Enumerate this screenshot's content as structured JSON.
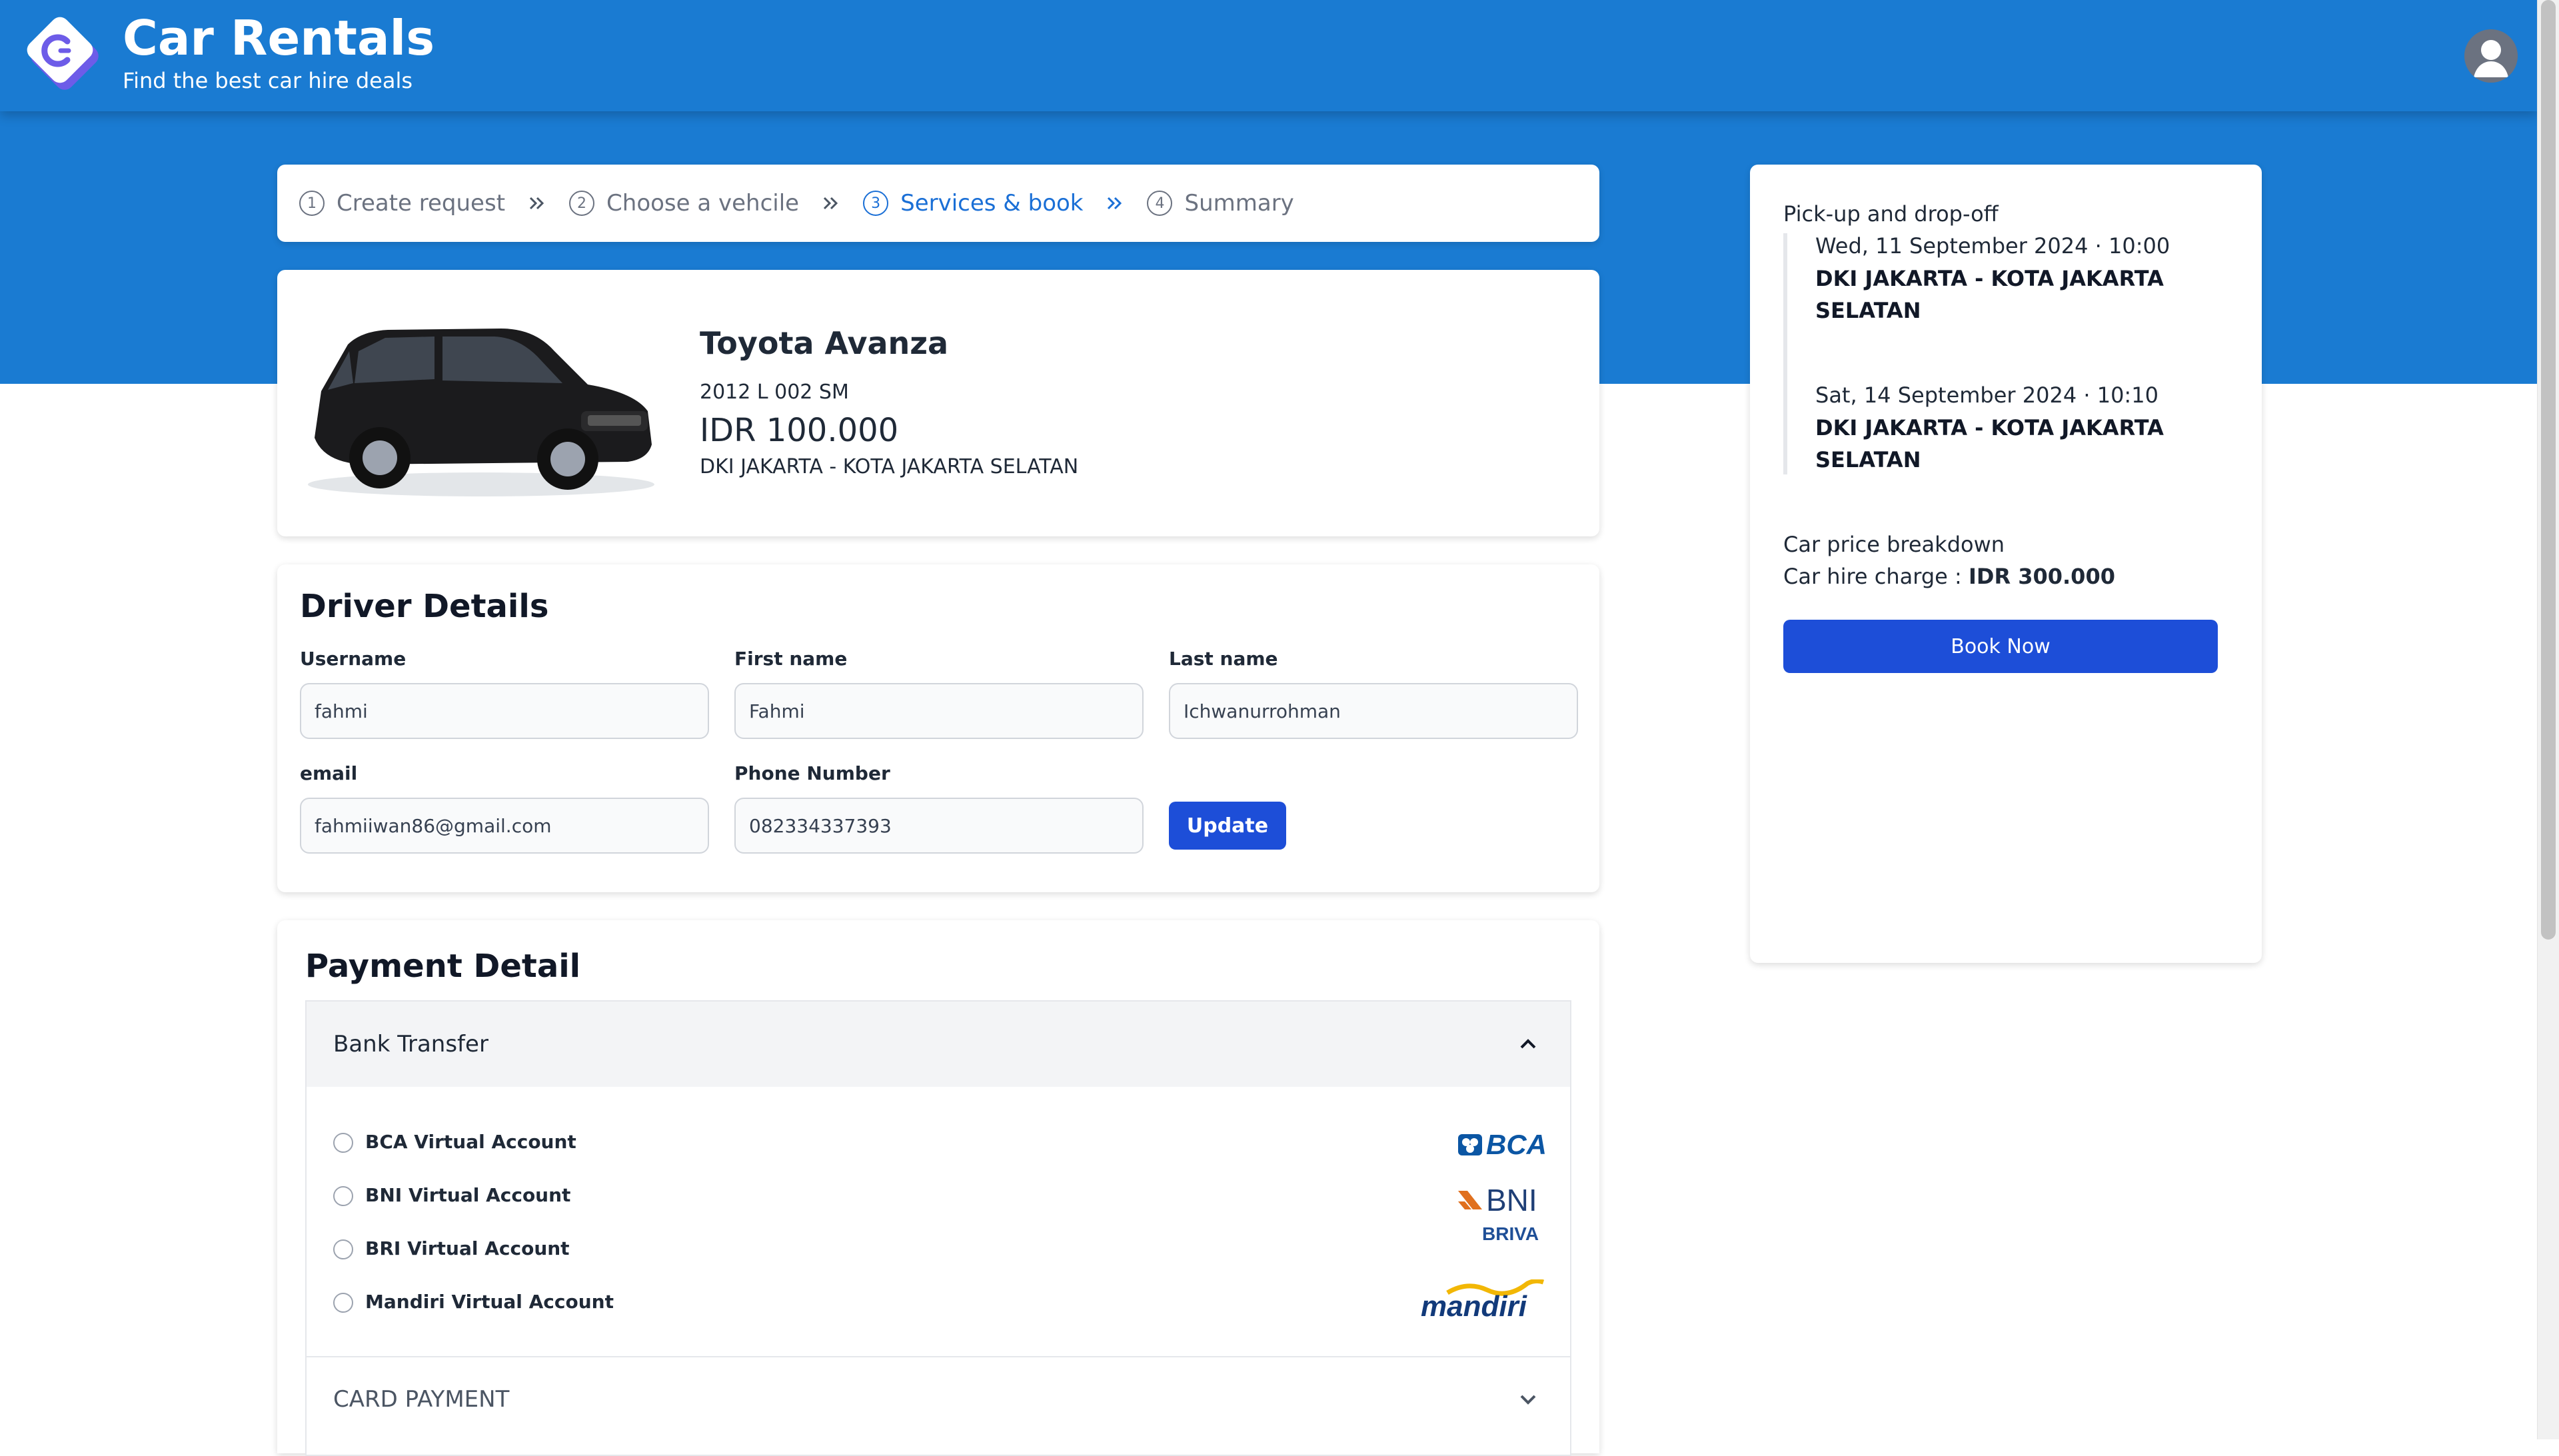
{
  "header": {
    "title": "Car Rentals",
    "subtitle": "Find the best car hire deals",
    "logo_icon": "car-rentals-logo-icon",
    "avatar_icon": "user-avatar-icon"
  },
  "stepper": {
    "steps": [
      {
        "num": "1",
        "label": "Create request",
        "active": false
      },
      {
        "num": "2",
        "label": "Choose a vehcile",
        "active": false
      },
      {
        "num": "3",
        "label": "Services & book",
        "active": true
      },
      {
        "num": "4",
        "label": "Summary",
        "active": false
      }
    ],
    "separator_icon": "double-chevron-right-icon"
  },
  "vehicle": {
    "name": "Toyota Avanza",
    "year_plate": "2012 L 002 SM",
    "price": "IDR 100.000",
    "location": "DKI JAKARTA - KOTA JAKARTA SELATAN"
  },
  "driver": {
    "title": "Driver Details",
    "fields": {
      "username": {
        "label": "Username",
        "value": "fahmi"
      },
      "first_name": {
        "label": "First name",
        "value": "Fahmi"
      },
      "last_name": {
        "label": "Last name",
        "value": "Ichwanurrohman"
      },
      "email": {
        "label": "email",
        "value": "fahmiiwan86@gmail.com"
      },
      "phone": {
        "label": "Phone Number",
        "value": "082334337393"
      }
    },
    "update_label": "Update"
  },
  "payment": {
    "title": "Payment Detail",
    "bank_transfer": {
      "label": "Bank Transfer",
      "expanded": true,
      "options": [
        {
          "label": "BCA Virtual Account",
          "logo_text": "BCA"
        },
        {
          "label": "BNI Virtual Account",
          "logo_text": "BNI"
        },
        {
          "label": "BRI Virtual Account",
          "logo_text": "BRIVA"
        },
        {
          "label": "Mandiri Virtual Account",
          "logo_text": "mandiri"
        }
      ]
    },
    "card_payment": {
      "label": "CARD PAYMENT",
      "expanded": false
    }
  },
  "summary": {
    "pickup_title": "Pick-up and drop-off",
    "pickup": {
      "datetime": "Wed, 11 September 2024 · 10:00",
      "location": "DKI JAKARTA - KOTA JAKARTA SELATAN"
    },
    "dropoff": {
      "datetime": "Sat, 14 September 2024 · 10:10",
      "location": "DKI JAKARTA - KOTA JAKARTA SELATAN"
    },
    "breakdown_title": "Car price breakdown",
    "hire_charge_label": "Car hire charge : ",
    "hire_charge_value": "IDR 300.000",
    "book_label": "Book Now"
  },
  "colors": {
    "header_blue": "#1a7bd2",
    "primary_button": "#1d4ed8",
    "active_step": "#1a6fd6"
  }
}
